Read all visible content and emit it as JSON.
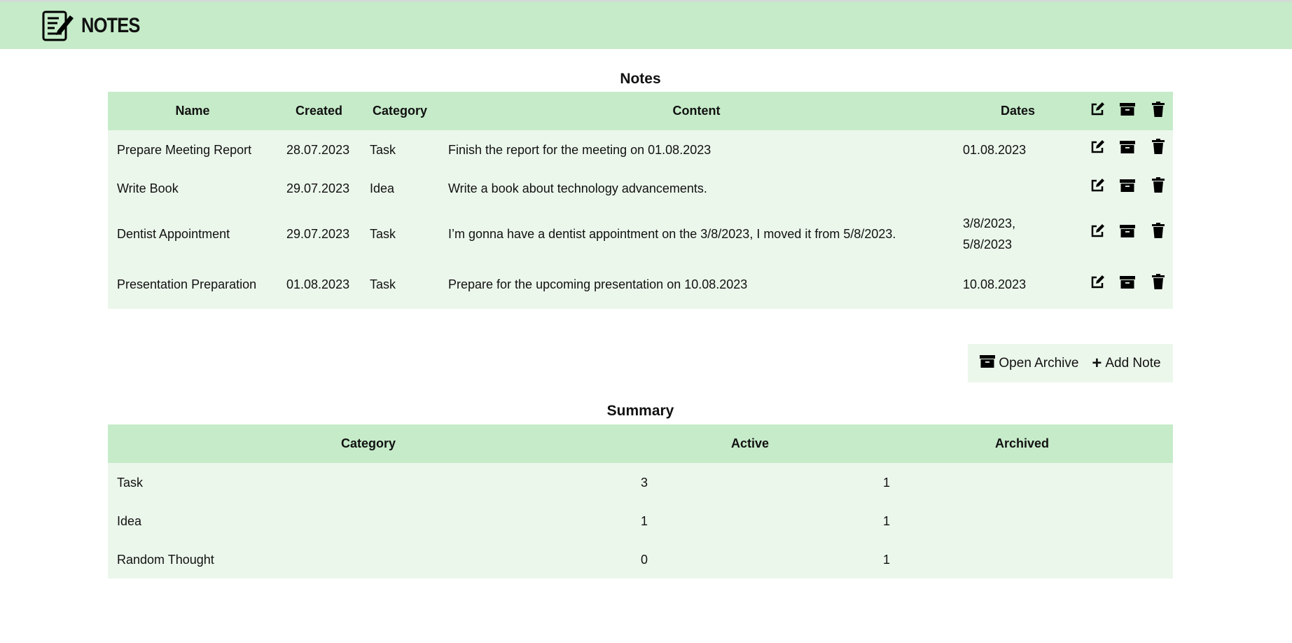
{
  "header": {
    "title": "NOTES"
  },
  "notes": {
    "title": "Notes",
    "columns": [
      "Name",
      "Created",
      "Category",
      "Content",
      "Dates"
    ],
    "rows": [
      {
        "name": "Prepare Meeting Report",
        "created": "28.07.2023",
        "category": "Task",
        "content": "Finish the report for the meeting on 01.08.2023",
        "dates": "01.08.2023"
      },
      {
        "name": "Write Book",
        "created": "29.07.2023",
        "category": "Idea",
        "content": "Write a book about technology advancements.",
        "dates": ""
      },
      {
        "name": "Dentist Appointment",
        "created": "29.07.2023",
        "category": "Task",
        "content": "I’m gonna have a dentist appointment on the 3/8/2023, I moved it from 5/8/2023.",
        "dates": "3/8/2023, 5/8/2023"
      },
      {
        "name": "Presentation Preparation",
        "created": "01.08.2023",
        "category": "Task",
        "content": "Prepare for the upcoming presentation on 10.08.2023",
        "dates": "10.08.2023"
      }
    ]
  },
  "actions": {
    "open_archive": "Open Archive",
    "add_note": "Add Note"
  },
  "summary": {
    "title": "Summary",
    "columns": [
      "Category",
      "Active",
      "Archived"
    ],
    "rows": [
      {
        "category": "Task",
        "active": "3",
        "archived": "1"
      },
      {
        "category": "Idea",
        "active": "1",
        "archived": "1"
      },
      {
        "category": "Random Thought",
        "active": "0",
        "archived": "1"
      }
    ]
  }
}
